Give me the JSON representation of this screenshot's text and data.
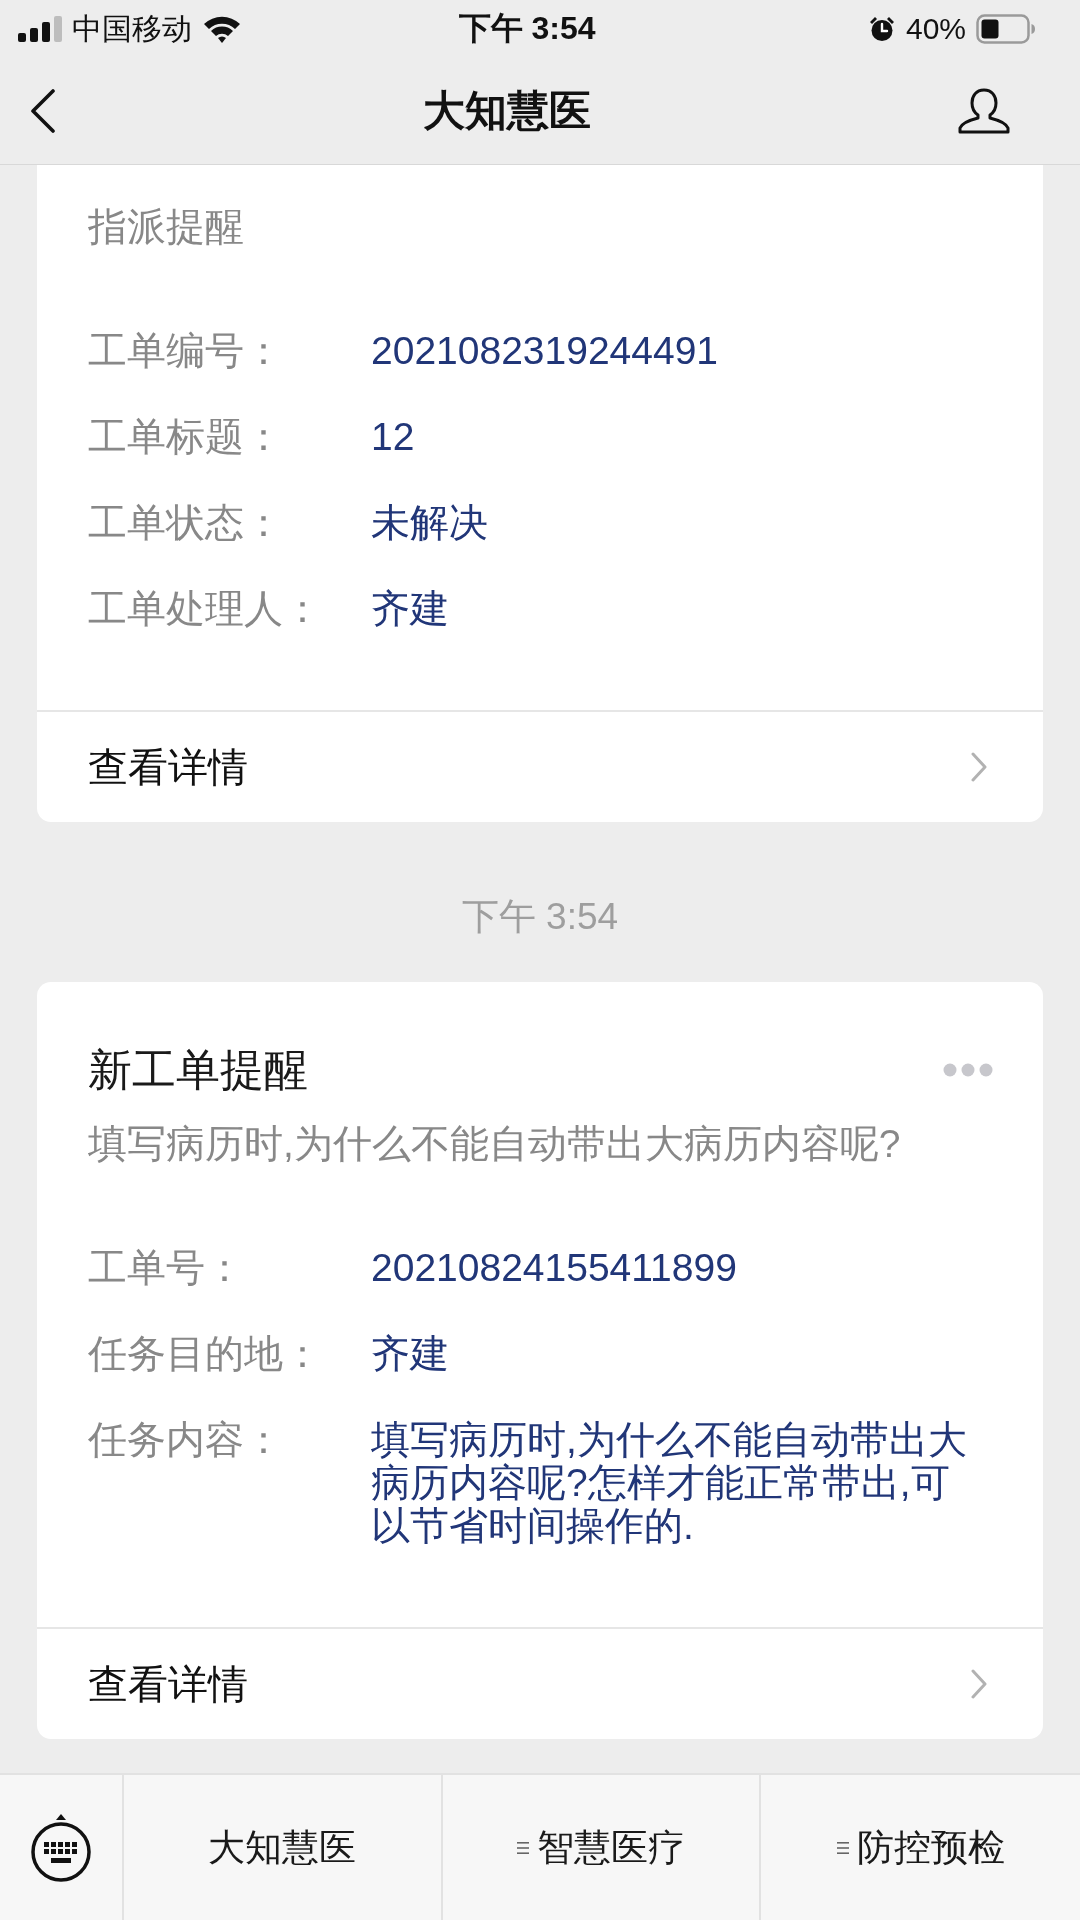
{
  "status_bar": {
    "carrier": "中国移动",
    "time": "下午 3:54",
    "battery": "40%"
  },
  "nav_bar": {
    "title": "大知慧医"
  },
  "feed": [
    {
      "kind": "card",
      "subtitle": "指派提醒",
      "fields": [
        {
          "label": "工单编号：",
          "value": "2021082319244491"
        },
        {
          "label": "工单标题：",
          "value": "12"
        },
        {
          "label": "工单状态：",
          "value": "未解决"
        },
        {
          "label": "工单处理人：",
          "value": "齐建"
        }
      ],
      "link": "查看详情"
    },
    {
      "kind": "time",
      "text": "下午 3:54"
    },
    {
      "kind": "card",
      "title": "新工单提醒",
      "subtitle": "填写病历时,为什么不能自动带出大病历内容呢?",
      "fields": [
        {
          "label": "工单号：",
          "value": "20210824155411899"
        },
        {
          "label": "任务目的地：",
          "value": "齐建"
        },
        {
          "label": "任务内容：",
          "value": "填写病历时,为什么不能自动带出大病历内容呢?怎样才能正常带出,可以节省时间操作的."
        }
      ],
      "link": "查看详情"
    }
  ],
  "bottom_menu": {
    "tabs": [
      {
        "label": "大知慧医",
        "has_submenu": false
      },
      {
        "label": "智慧医疗",
        "has_submenu": true
      },
      {
        "label": "防控预检",
        "has_submenu": true
      }
    ]
  }
}
